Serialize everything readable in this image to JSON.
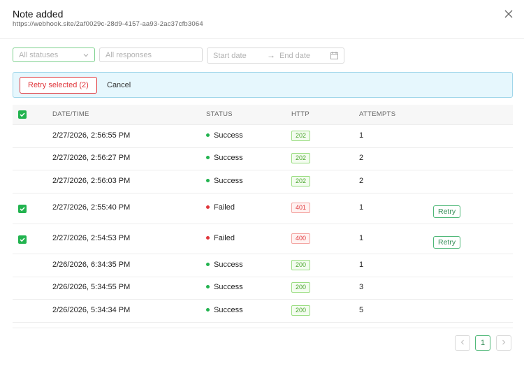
{
  "modal": {
    "title": "Note added",
    "subtitle": "https://webhook.site/2af0029c-28d9-4157-aa93-2ac37cfb3064"
  },
  "filters": {
    "status_placeholder": "All statuses",
    "response_placeholder": "All responses",
    "start_date_placeholder": "Start date",
    "end_date_placeholder": "End date"
  },
  "bulk": {
    "retry_selected_label": "Retry selected (2)",
    "cancel_label": "Cancel"
  },
  "table": {
    "headers": [
      "DATE/TIME",
      "STATUS",
      "HTTP",
      "ATTEMPTS"
    ],
    "header_checked": true,
    "rows": [
      {
        "datetime": "2/27/2026, 2:56:55 PM",
        "status": "Success",
        "http": "202",
        "attempts": "1",
        "checked": false,
        "retry": ""
      },
      {
        "datetime": "2/27/2026, 2:56:27 PM",
        "status": "Success",
        "http": "202",
        "attempts": "2",
        "checked": false,
        "retry": ""
      },
      {
        "datetime": "2/27/2026, 2:56:03 PM",
        "status": "Success",
        "http": "202",
        "attempts": "2",
        "checked": false,
        "retry": ""
      },
      {
        "datetime": "2/27/2026, 2:55:40 PM",
        "status": "Failed",
        "http": "401",
        "attempts": "1",
        "checked": true,
        "retry": "Retry"
      },
      {
        "datetime": "2/27/2026, 2:54:53 PM",
        "status": "Failed",
        "http": "400",
        "attempts": "1",
        "checked": true,
        "retry": "Retry"
      },
      {
        "datetime": "2/26/2026, 6:34:35 PM",
        "status": "Success",
        "http": "200",
        "attempts": "1",
        "checked": false,
        "retry": ""
      },
      {
        "datetime": "2/26/2026, 5:34:55 PM",
        "status": "Success",
        "http": "200",
        "attempts": "3",
        "checked": false,
        "retry": ""
      },
      {
        "datetime": "2/26/2026, 5:34:34 PM",
        "status": "Success",
        "http": "200",
        "attempts": "5",
        "checked": false,
        "retry": ""
      }
    ]
  },
  "pagination": {
    "prev_icon": "chevron-left-icon",
    "current_page": "1",
    "next_icon": "chevron-right-icon"
  },
  "colors": {
    "success": "#22b34f",
    "failed": "#e0363b",
    "accent": "#4fb878",
    "bulk_bg": "#e6f7fd"
  }
}
